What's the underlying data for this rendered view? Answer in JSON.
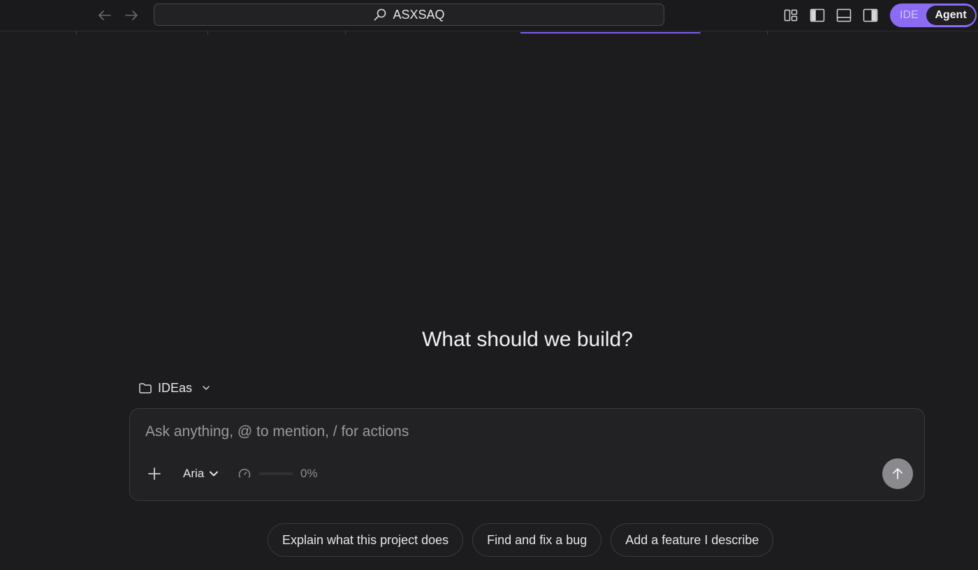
{
  "toolbar": {
    "search_text": "ASXSAQ",
    "mode": {
      "ide_label": "IDE",
      "agent_label": "Agent",
      "active": "Agent"
    },
    "accent_color": "#8b6bf2"
  },
  "main": {
    "headline": "What should we build?",
    "folder_label": "IDEas",
    "composer": {
      "placeholder": "Ask anything, @ to mention, / for actions",
      "value": "",
      "model": "Aria",
      "usage_text": "0%",
      "usage_fraction": 0
    },
    "suggestions": [
      {
        "label": "Explain what this project does"
      },
      {
        "label": "Find and fix a bug"
      },
      {
        "label": "Add a feature I describe"
      }
    ]
  },
  "icons": {
    "back": "arrow-left-icon",
    "forward": "arrow-right-icon",
    "search": "search-icon",
    "layout": [
      "layout-grid-icon",
      "sidebar-left-icon",
      "panel-bottom-icon",
      "sidebar-right-icon"
    ],
    "folder": "folder-icon",
    "plus": "plus-icon",
    "usage": "gauge-icon",
    "send": "arrow-up-icon"
  }
}
